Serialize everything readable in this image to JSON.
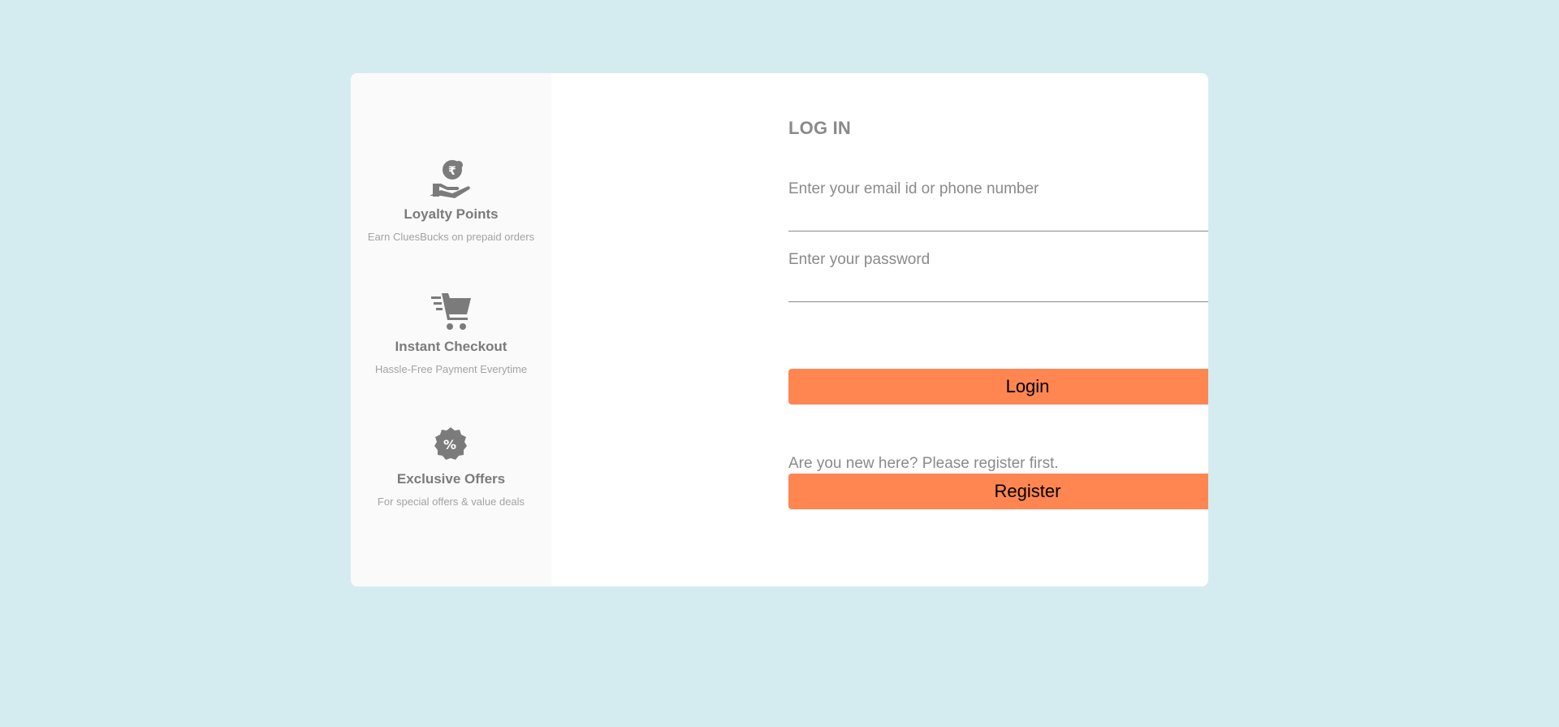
{
  "benefits": [
    {
      "icon": "rupee-hand-icon",
      "title": "Loyalty Points",
      "description": "Earn CluesBucks on prepaid orders"
    },
    {
      "icon": "shopping-cart-icon",
      "title": "Instant Checkout",
      "description": "Hassle-Free Payment Everytime"
    },
    {
      "icon": "discount-badge-icon",
      "title": "Exclusive Offers",
      "description": "For special offers & value deals"
    }
  ],
  "login": {
    "heading": "LOG IN",
    "email_label": "Enter your email id or phone number",
    "email_value": "",
    "password_label": "Enter your password",
    "password_value": "",
    "login_button": "Login",
    "register_prompt": "Are you new here? Please register first.",
    "register_button": "Register"
  },
  "colors": {
    "background": "#d4ecef",
    "accent": "#ff8551",
    "text_muted": "#8a8a8a"
  }
}
